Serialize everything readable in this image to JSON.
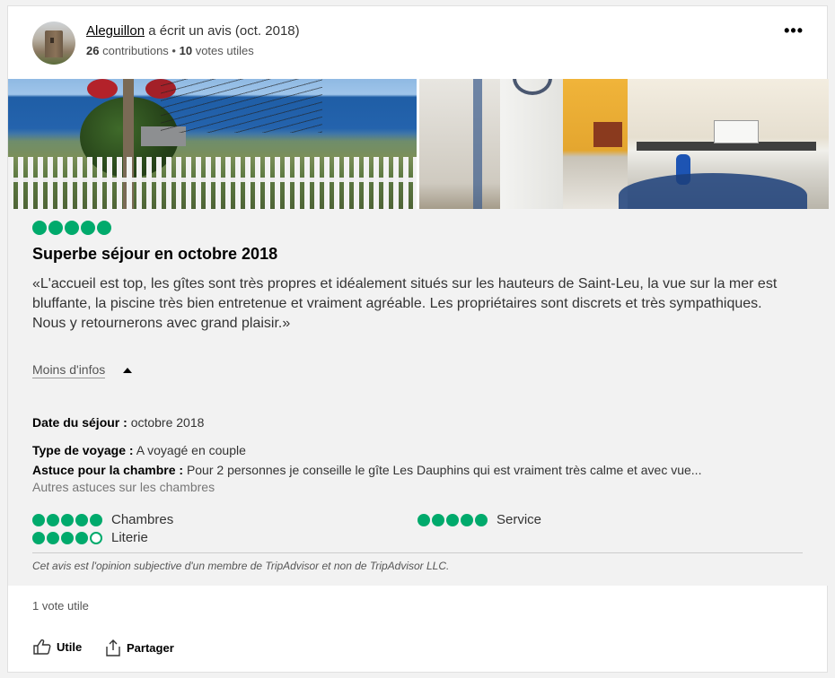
{
  "header": {
    "author": "Aleguillon",
    "action_text": "a écrit un avis (oct. 2018)",
    "contributions_count": "26",
    "contributions_label": "contributions •",
    "votes_count": "10",
    "votes_label": "votes utiles",
    "more": "•••"
  },
  "review": {
    "rating": 5,
    "title": "Superbe séjour en octobre 2018",
    "text_line1": "«L'accueil est top, les gîtes sont très propres et idéalement situés sur les hauteurs de Saint-Leu, la vue sur la mer est bluffante, la piscine très bien entretenue et vraiment agréable. Les propriétaires sont discrets et très sympathiques.",
    "text_line2": "Nous y retournerons avec grand plaisir.»",
    "less_label": "Moins d'infos",
    "stay_date_label": "Date du séjour :",
    "stay_date_value": "octobre 2018",
    "trip_type_label": "Type de voyage :",
    "trip_type_value": "A voyagé en couple",
    "room_tip_label": "Astuce pour la chambre :",
    "room_tip_value": "Pour 2 personnes je conseille le gîte Les Dauphins qui est vraiment très calme et avec vue...",
    "more_tips_label": "Autres astuces sur les chambres",
    "sub_ratings": [
      {
        "label": "Chambres",
        "rating": 5
      },
      {
        "label": "Service",
        "rating": 5
      },
      {
        "label": "Literie",
        "rating": 4
      }
    ],
    "disclaimer": "Cet avis est l'opinion subjective d'un membre de TripAdvisor et non de TripAdvisor LLC."
  },
  "footer": {
    "votes": "1 vote utile",
    "helpful_label": "Utile",
    "share_label": "Partager"
  },
  "colors": {
    "bubble": "#00aa6c"
  }
}
